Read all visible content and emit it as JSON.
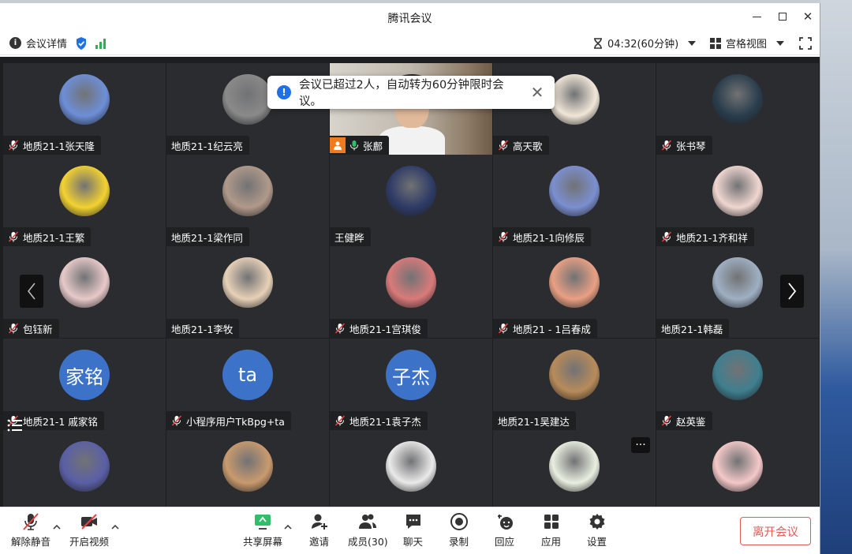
{
  "window": {
    "title": "腾讯会议"
  },
  "infobar": {
    "details_label": "会议详情",
    "timer": "04:32(60分钟)",
    "view_mode": "宫格视图"
  },
  "toast": {
    "message": "会议已超过2人，自动转为60分钟限时会议。"
  },
  "participants": [
    {
      "name": "地质21-1张天隆",
      "muted": true,
      "avatar": "photo",
      "color": "#6d8fd8"
    },
    {
      "name": "地质21-1纪云亮",
      "muted": false,
      "avatar": "photo",
      "color": "#8a8a8a"
    },
    {
      "name": "张鄜",
      "muted": false,
      "avatar": "video",
      "host": true,
      "color": "#c9c2b7"
    },
    {
      "name": "高天歌",
      "muted": true,
      "avatar": "photo",
      "color": "#f1e7d8"
    },
    {
      "name": "张书琴",
      "muted": true,
      "avatar": "photo",
      "color": "#2a3d4c"
    },
    {
      "name": "地质21-1王繁",
      "muted": true,
      "avatar": "photo",
      "color": "#f3d230"
    },
    {
      "name": "地质21-1梁作同",
      "muted": false,
      "avatar": "photo",
      "color": "#b0998a"
    },
    {
      "name": "王健晔",
      "muted": false,
      "avatar": "photo",
      "color": "#2e3b66"
    },
    {
      "name": "地质21-1向修辰",
      "muted": true,
      "avatar": "photo",
      "color": "#7b8fd0"
    },
    {
      "name": "地质21-1齐和祥",
      "muted": true,
      "avatar": "photo",
      "color": "#f0d6d0"
    },
    {
      "name": "包钰新",
      "muted": true,
      "avatar": "photo",
      "color": "#e8c9c9"
    },
    {
      "name": "地质21-1李牧",
      "muted": false,
      "avatar": "photo",
      "color": "#e7d0b7"
    },
    {
      "name": "地质21-1宫琪俊",
      "muted": true,
      "avatar": "photo",
      "color": "#d97a7a"
    },
    {
      "name": "地质21 - 1吕春成",
      "muted": true,
      "avatar": "photo",
      "color": "#e9a083"
    },
    {
      "name": "地质21-1韩磊",
      "muted": false,
      "avatar": "photo",
      "color": "#9fb0c3"
    },
    {
      "name": "地质21-1 戚家铭",
      "muted": true,
      "avatar": "text",
      "text": "家铭",
      "color": "#3c73c8"
    },
    {
      "name": "小程序用户TkBpg+ta",
      "muted": true,
      "avatar": "text",
      "text": "ta",
      "color": "#3c73c8"
    },
    {
      "name": "地质21-1袁子杰",
      "muted": true,
      "avatar": "text",
      "text": "子杰",
      "color": "#3c73c8"
    },
    {
      "name": "地质21-1吴建达",
      "muted": false,
      "avatar": "photo",
      "color": "#b88b5a"
    },
    {
      "name": "赵英鉴",
      "muted": true,
      "avatar": "photo",
      "color": "#3f7f8f"
    },
    {
      "name": "",
      "muted": true,
      "avatar": "photo",
      "color": "#5a5fa6"
    },
    {
      "name": "",
      "muted": true,
      "avatar": "photo",
      "color": "#c99a6e"
    },
    {
      "name": "",
      "muted": true,
      "avatar": "photo",
      "color": "#eaeaea"
    },
    {
      "name": "",
      "muted": true,
      "avatar": "photo",
      "color": "#e8efe0"
    },
    {
      "name": "",
      "muted": true,
      "avatar": "photo",
      "color": "#f4c8c8"
    }
  ],
  "toolbar": {
    "unmute": "解除静音",
    "start_video": "开启视频",
    "share_screen": "共享屏幕",
    "invite": "邀请",
    "members": "成员(30)",
    "chat": "聊天",
    "record": "录制",
    "replay": "回应",
    "apps": "应用",
    "settings": "设置",
    "leave": "离开会议"
  }
}
